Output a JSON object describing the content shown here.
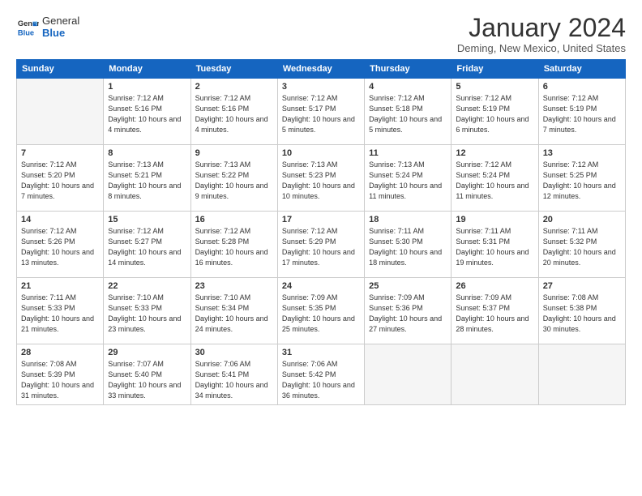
{
  "logo": {
    "general": "General",
    "blue": "Blue"
  },
  "title": "January 2024",
  "location": "Deming, New Mexico, United States",
  "days_header": [
    "Sunday",
    "Monday",
    "Tuesday",
    "Wednesday",
    "Thursday",
    "Friday",
    "Saturday"
  ],
  "weeks": [
    [
      {
        "day": "",
        "empty": true
      },
      {
        "day": "1",
        "sunrise": "7:12 AM",
        "sunset": "5:16 PM",
        "daylight": "10 hours and 4 minutes."
      },
      {
        "day": "2",
        "sunrise": "7:12 AM",
        "sunset": "5:16 PM",
        "daylight": "10 hours and 4 minutes."
      },
      {
        "day": "3",
        "sunrise": "7:12 AM",
        "sunset": "5:17 PM",
        "daylight": "10 hours and 5 minutes."
      },
      {
        "day": "4",
        "sunrise": "7:12 AM",
        "sunset": "5:18 PM",
        "daylight": "10 hours and 5 minutes."
      },
      {
        "day": "5",
        "sunrise": "7:12 AM",
        "sunset": "5:19 PM",
        "daylight": "10 hours and 6 minutes."
      },
      {
        "day": "6",
        "sunrise": "7:12 AM",
        "sunset": "5:19 PM",
        "daylight": "10 hours and 7 minutes."
      }
    ],
    [
      {
        "day": "7",
        "sunrise": "7:12 AM",
        "sunset": "5:20 PM",
        "daylight": "10 hours and 7 minutes."
      },
      {
        "day": "8",
        "sunrise": "7:13 AM",
        "sunset": "5:21 PM",
        "daylight": "10 hours and 8 minutes."
      },
      {
        "day": "9",
        "sunrise": "7:13 AM",
        "sunset": "5:22 PM",
        "daylight": "10 hours and 9 minutes."
      },
      {
        "day": "10",
        "sunrise": "7:13 AM",
        "sunset": "5:23 PM",
        "daylight": "10 hours and 10 minutes."
      },
      {
        "day": "11",
        "sunrise": "7:13 AM",
        "sunset": "5:24 PM",
        "daylight": "10 hours and 11 minutes."
      },
      {
        "day": "12",
        "sunrise": "7:12 AM",
        "sunset": "5:24 PM",
        "daylight": "10 hours and 11 minutes."
      },
      {
        "day": "13",
        "sunrise": "7:12 AM",
        "sunset": "5:25 PM",
        "daylight": "10 hours and 12 minutes."
      }
    ],
    [
      {
        "day": "14",
        "sunrise": "7:12 AM",
        "sunset": "5:26 PM",
        "daylight": "10 hours and 13 minutes."
      },
      {
        "day": "15",
        "sunrise": "7:12 AM",
        "sunset": "5:27 PM",
        "daylight": "10 hours and 14 minutes."
      },
      {
        "day": "16",
        "sunrise": "7:12 AM",
        "sunset": "5:28 PM",
        "daylight": "10 hours and 16 minutes."
      },
      {
        "day": "17",
        "sunrise": "7:12 AM",
        "sunset": "5:29 PM",
        "daylight": "10 hours and 17 minutes."
      },
      {
        "day": "18",
        "sunrise": "7:11 AM",
        "sunset": "5:30 PM",
        "daylight": "10 hours and 18 minutes."
      },
      {
        "day": "19",
        "sunrise": "7:11 AM",
        "sunset": "5:31 PM",
        "daylight": "10 hours and 19 minutes."
      },
      {
        "day": "20",
        "sunrise": "7:11 AM",
        "sunset": "5:32 PM",
        "daylight": "10 hours and 20 minutes."
      }
    ],
    [
      {
        "day": "21",
        "sunrise": "7:11 AM",
        "sunset": "5:33 PM",
        "daylight": "10 hours and 21 minutes."
      },
      {
        "day": "22",
        "sunrise": "7:10 AM",
        "sunset": "5:33 PM",
        "daylight": "10 hours and 23 minutes."
      },
      {
        "day": "23",
        "sunrise": "7:10 AM",
        "sunset": "5:34 PM",
        "daylight": "10 hours and 24 minutes."
      },
      {
        "day": "24",
        "sunrise": "7:09 AM",
        "sunset": "5:35 PM",
        "daylight": "10 hours and 25 minutes."
      },
      {
        "day": "25",
        "sunrise": "7:09 AM",
        "sunset": "5:36 PM",
        "daylight": "10 hours and 27 minutes."
      },
      {
        "day": "26",
        "sunrise": "7:09 AM",
        "sunset": "5:37 PM",
        "daylight": "10 hours and 28 minutes."
      },
      {
        "day": "27",
        "sunrise": "7:08 AM",
        "sunset": "5:38 PM",
        "daylight": "10 hours and 30 minutes."
      }
    ],
    [
      {
        "day": "28",
        "sunrise": "7:08 AM",
        "sunset": "5:39 PM",
        "daylight": "10 hours and 31 minutes."
      },
      {
        "day": "29",
        "sunrise": "7:07 AM",
        "sunset": "5:40 PM",
        "daylight": "10 hours and 33 minutes."
      },
      {
        "day": "30",
        "sunrise": "7:06 AM",
        "sunset": "5:41 PM",
        "daylight": "10 hours and 34 minutes."
      },
      {
        "day": "31",
        "sunrise": "7:06 AM",
        "sunset": "5:42 PM",
        "daylight": "10 hours and 36 minutes."
      },
      {
        "day": "",
        "empty": true
      },
      {
        "day": "",
        "empty": true
      },
      {
        "day": "",
        "empty": true
      }
    ]
  ]
}
